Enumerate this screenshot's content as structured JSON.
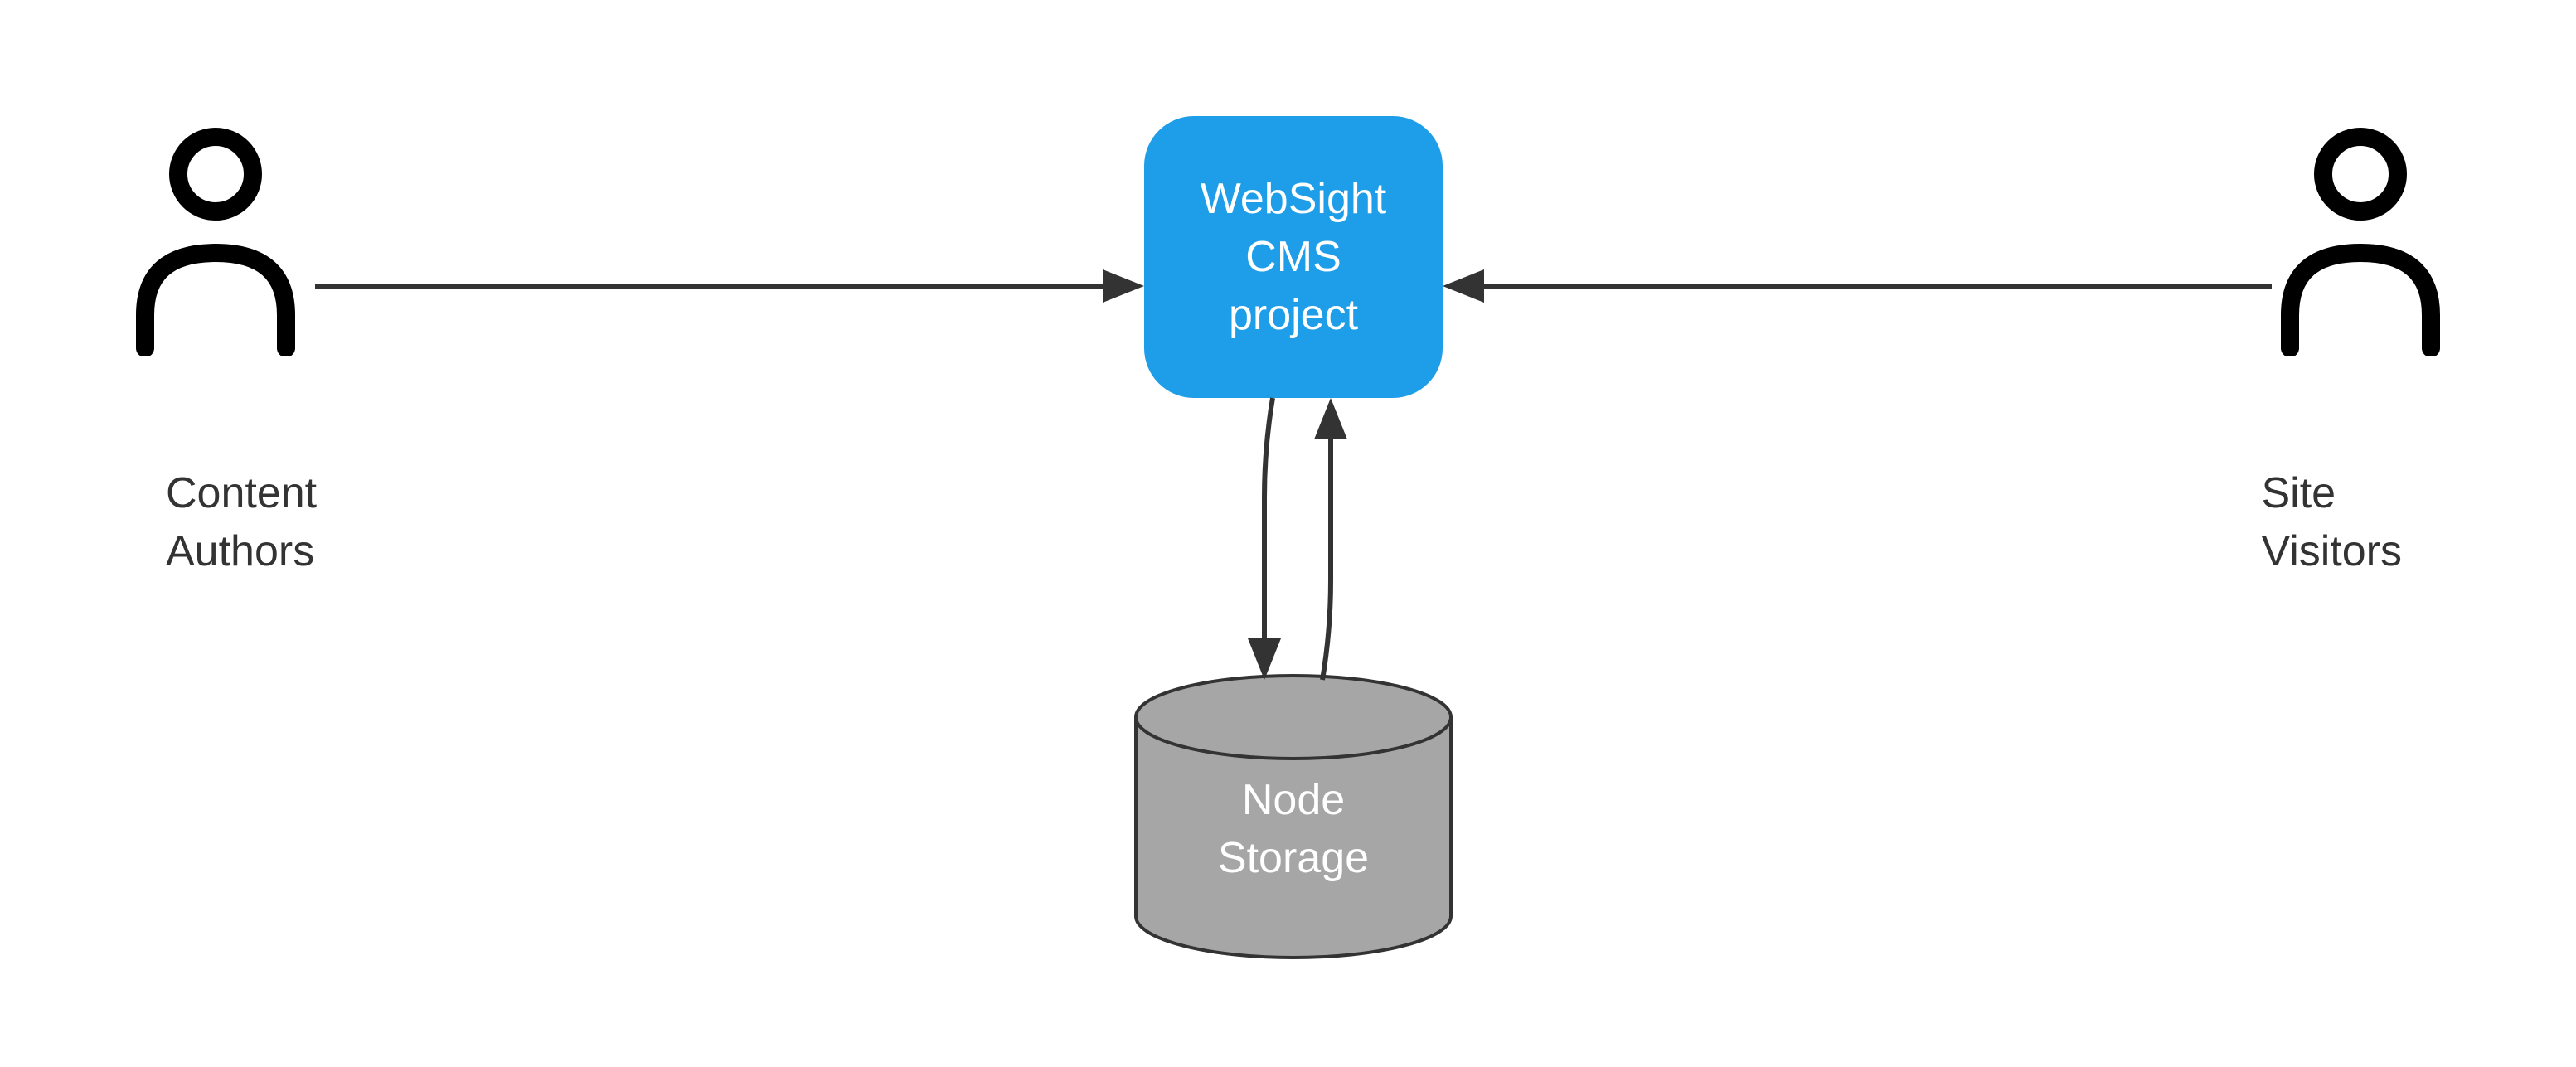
{
  "actors": {
    "left": {
      "label": "Content\nAuthors"
    },
    "right": {
      "label": "Site\nVisitors"
    }
  },
  "center": {
    "label": "WebSight\nCMS\nproject"
  },
  "storage": {
    "label": "Node\nStorage"
  },
  "colors": {
    "box": "#1e9ee8",
    "cylinder_fill": "#a6a6a6",
    "cylinder_stroke": "#333333",
    "arrow": "#333333"
  }
}
